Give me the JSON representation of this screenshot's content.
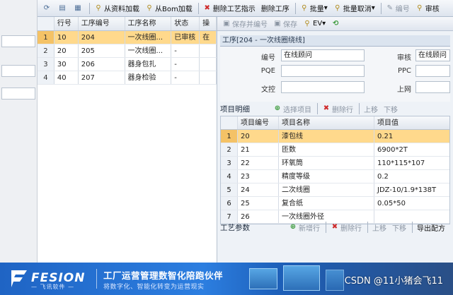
{
  "toolbar": {
    "load_from_data": "从资料加载",
    "load_from_bom": "从Bom加载",
    "delete_process_hint": "删除工艺指示",
    "delete_process": "删除工序",
    "batch": "批量",
    "batch_cancel": "批量取消",
    "edit": "编号",
    "review": "审核"
  },
  "process_grid": {
    "headers": [
      "行号",
      "工序编号",
      "工序名称",
      "状态",
      "操"
    ],
    "rows": [
      {
        "idx": "1",
        "no": "10",
        "code": "204",
        "name": "一次线圈...",
        "status": "已审核",
        "more": "在"
      },
      {
        "idx": "2",
        "no": "20",
        "code": "205",
        "name": "一次线圈...",
        "status": "-",
        "more": ""
      },
      {
        "idx": "3",
        "no": "30",
        "code": "206",
        "name": "器身包扎",
        "status": "-",
        "more": ""
      },
      {
        "idx": "4",
        "no": "40",
        "code": "207",
        "name": "器身检验",
        "status": "-",
        "more": ""
      }
    ]
  },
  "detail_toolbar": {
    "save_and_review": "保存并编号",
    "save": "保存",
    "ev": "EV"
  },
  "process_panel": {
    "title": "工序[204 - 一次线圈绕线]",
    "labels": {
      "number": "编号",
      "pqe": "PQE",
      "text_review": "文控",
      "audit": "审核",
      "ppc": "PPC",
      "online": "上网"
    },
    "values": {
      "number": "在线顾问",
      "audit": "在线顾问"
    }
  },
  "items_section": {
    "title": "项目明细",
    "select_item": "选择项目",
    "delete_row": "删除行",
    "move_up": "上移",
    "move_down": "下移",
    "headers": [
      "项目编号",
      "项目名称",
      "项目值"
    ],
    "rows": [
      {
        "idx": "1",
        "code": "20",
        "name": "漆包线",
        "value": "0.21"
      },
      {
        "idx": "2",
        "code": "21",
        "name": "匝数",
        "value": "6900*2T"
      },
      {
        "idx": "3",
        "code": "22",
        "name": "环氧筒",
        "value": "110*115*107"
      },
      {
        "idx": "4",
        "code": "23",
        "name": "精度等级",
        "value": "0.2"
      },
      {
        "idx": "5",
        "code": "24",
        "name": "二次线圈",
        "value": "JDZ-10/1.9*138T"
      },
      {
        "idx": "6",
        "code": "25",
        "name": "复合纸",
        "value": "0.05*50"
      },
      {
        "idx": "7",
        "code": "26",
        "name": "一次线圈外径",
        "value": ""
      }
    ]
  },
  "params_section": {
    "title": "工艺参数",
    "add_row": "新增行",
    "delete_row": "删除行",
    "move_up": "上移",
    "move_down": "下移",
    "export_recipe": "导出配方"
  },
  "banner": {
    "brand": "FESION",
    "brand_sub": "— 飞讯软件 —",
    "slogan": "工厂运营管理数智化陪跑伙伴",
    "slogan_sub": "将数字化、智能化转变为运营现实",
    "watermark": "CSDN @11小猪会飞11"
  },
  "colors": {
    "selected_row": "#ffd98c",
    "banner_blue": "#2c7ee0"
  }
}
